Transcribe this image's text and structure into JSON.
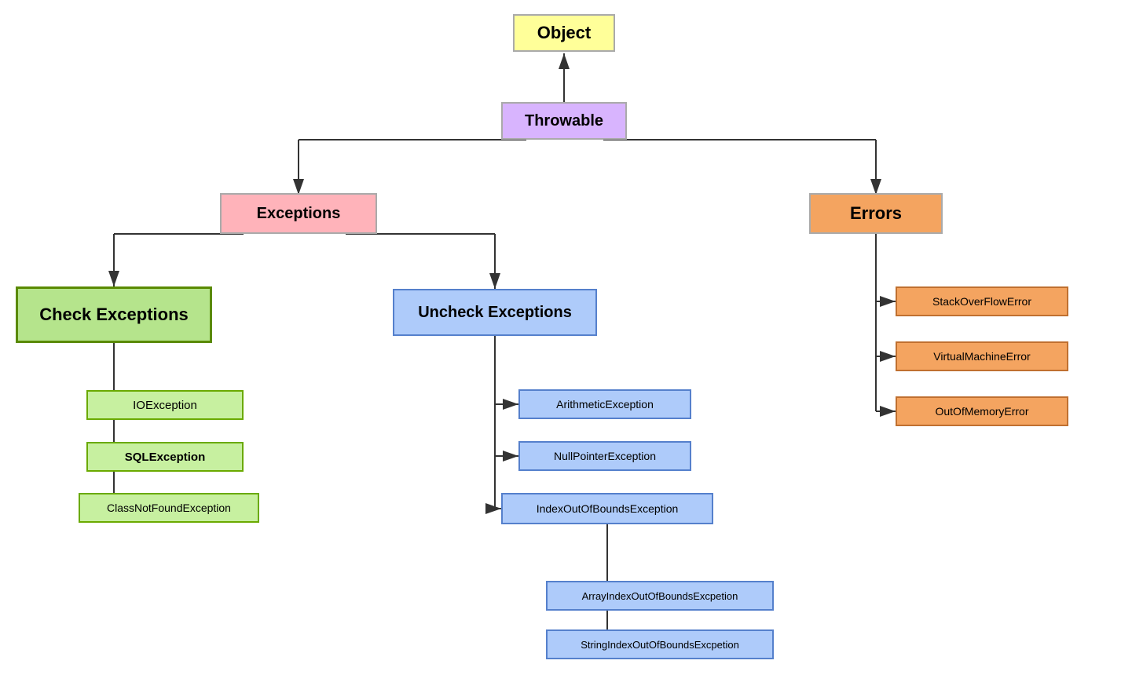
{
  "nodes": {
    "object": {
      "label": "Object"
    },
    "throwable": {
      "label": "Throwable"
    },
    "exceptions": {
      "label": "Exceptions"
    },
    "errors": {
      "label": "Errors"
    },
    "check_exceptions": {
      "label": "Check Exceptions"
    },
    "uncheck_exceptions": {
      "label": "Uncheck Exceptions"
    },
    "ioexception": {
      "label": "IOException"
    },
    "sqlexception": {
      "label": "SQLException"
    },
    "classnotfound": {
      "label": "ClassNotFoundException"
    },
    "arithmetic": {
      "label": "ArithmeticException"
    },
    "nullpointer": {
      "label": "NullPointerException"
    },
    "indexoutofbounds": {
      "label": "IndexOutOfBoundsException"
    },
    "arrayindex": {
      "label": "ArrayIndexOutOfBoundsExcpetion"
    },
    "stringindex": {
      "label": "StringIndexOutOfBoundsExcpetion"
    },
    "stackoverflow": {
      "label": "StackOverFlowError"
    },
    "virtualmachine": {
      "label": "VirtualMachineError"
    },
    "outofmemory": {
      "label": "OutOfMemoryError"
    }
  }
}
